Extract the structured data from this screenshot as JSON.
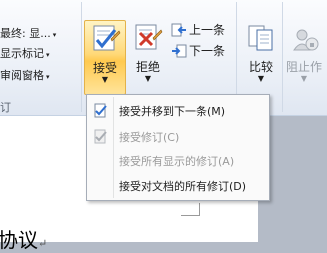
{
  "left_panel": {
    "items": [
      {
        "label": "最终: 显..."
      },
      {
        "label": "显示标记"
      },
      {
        "label": "审阅窗格"
      }
    ],
    "group_label": "订"
  },
  "changes_group": {
    "accept_label": "接受",
    "reject_label": "拒绝",
    "previous_label": "上一条",
    "next_label": "下一条"
  },
  "compare_group": {
    "compare_label": "比较"
  },
  "protect_group": {
    "block_authors_label": "阻止作"
  },
  "accept_menu": {
    "items": [
      {
        "label": "接受并移到下一条(M)",
        "enabled": true
      },
      {
        "label": "接受修订(C)",
        "enabled": false
      },
      {
        "label": "接受所有显示的修订(A)",
        "enabled": false
      },
      {
        "label": "接受对文档的所有修订(D)",
        "enabled": true
      }
    ]
  },
  "document": {
    "text": "协议"
  },
  "colors": {
    "ribbon_bg": "#e9eef6",
    "button_hover": "#ffd979",
    "workspace_bg": "#b4bbc7",
    "disabled_text": "#9a9a9a"
  }
}
